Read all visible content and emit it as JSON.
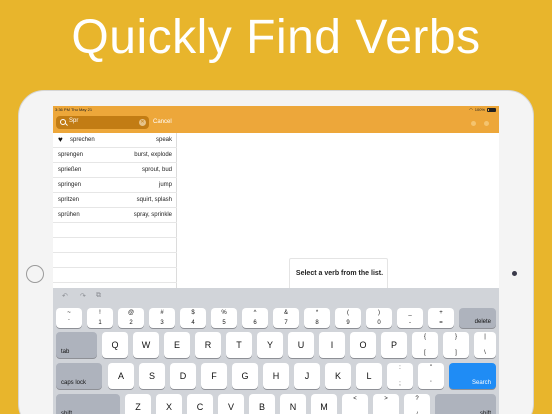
{
  "headline": "Quickly Find Verbs",
  "status": {
    "time": "3:36 PM",
    "date": "Thu May 21",
    "battery": "100%"
  },
  "search": {
    "value": "Spr",
    "cancel_label": "Cancel"
  },
  "verbs": [
    {
      "de": "sprechen",
      "en": "speak",
      "favorite": true
    },
    {
      "de": "sprengen",
      "en": "burst, explode"
    },
    {
      "de": "sprießen",
      "en": "sprout, bud"
    },
    {
      "de": "springen",
      "en": "jump"
    },
    {
      "de": "spritzen",
      "en": "squirt, splash"
    },
    {
      "de": "sprühen",
      "en": "spray, sprinkle"
    }
  ],
  "detail": {
    "prompt": "Select a verb from the list."
  },
  "keyboard": {
    "toolbar": {
      "undo": "↶",
      "redo": "↷",
      "paste": "⧉"
    },
    "number_row": [
      {
        "top": "~",
        "bot": "`"
      },
      {
        "top": "!",
        "bot": "1"
      },
      {
        "top": "@",
        "bot": "2"
      },
      {
        "top": "#",
        "bot": "3"
      },
      {
        "top": "$",
        "bot": "4"
      },
      {
        "top": "%",
        "bot": "5"
      },
      {
        "top": "^",
        "bot": "6"
      },
      {
        "top": "&",
        "bot": "7"
      },
      {
        "top": "*",
        "bot": "8"
      },
      {
        "top": "(",
        "bot": "9"
      },
      {
        "top": ")",
        "bot": "0"
      },
      {
        "top": "_",
        "bot": "-"
      },
      {
        "top": "+",
        "bot": "="
      }
    ],
    "delete_label": "delete",
    "tab_label": "tab",
    "qwerty_row": [
      "Q",
      "W",
      "E",
      "R",
      "T",
      "Y",
      "U",
      "I",
      "O",
      "P"
    ],
    "qwerty_extra": [
      {
        "top": "{",
        "bot": "["
      },
      {
        "top": "}",
        "bot": "]"
      },
      {
        "top": "|",
        "bot": "\\"
      }
    ],
    "caps_label": "caps lock",
    "home_row": [
      "A",
      "S",
      "D",
      "F",
      "G",
      "H",
      "J",
      "K",
      "L"
    ],
    "home_extra": [
      {
        "top": ":",
        "bot": ";"
      },
      {
        "top": "\"",
        "bot": "'"
      }
    ],
    "search_label": "Search",
    "shift_label": "shift",
    "bottom_row": [
      "Z",
      "X",
      "C",
      "V",
      "B",
      "N",
      "M"
    ],
    "bottom_extra": [
      {
        "top": "<",
        "bot": ","
      },
      {
        "top": ">",
        "bot": "."
      },
      {
        "top": "?",
        "bot": "/"
      }
    ]
  },
  "colors": {
    "background": "#E8B52C",
    "bar": "#EDA73A",
    "search_key": "#1F8CF5"
  }
}
